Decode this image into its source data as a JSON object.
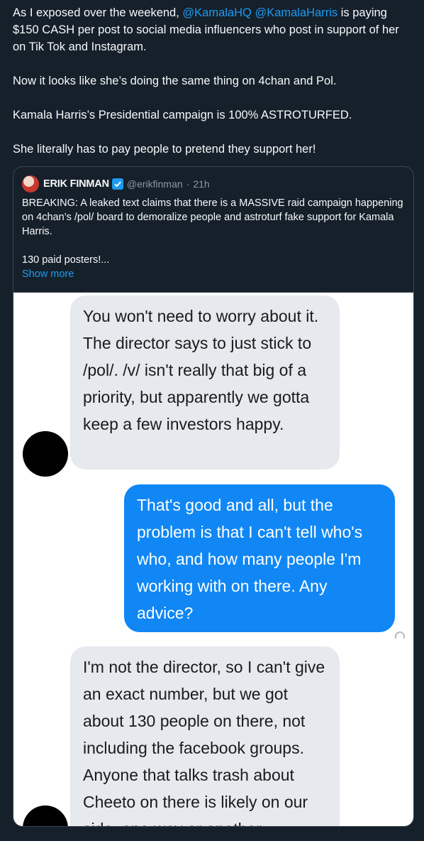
{
  "tweet": {
    "line1_pre": "As I exposed over the weekend, ",
    "mention1": "@KamalaHQ",
    "mention2": "@KamalaHarris",
    "line1_post": " is paying $150 CASH per post to social media influencers who post in support of her on Tik Tok and Instagram.",
    "para2": "Now it looks like she’s doing the same thing on 4chan and Pol.",
    "para3": "Kamala Harris’s Presidential campaign is 100% ASTROTURFED.",
    "para4": "She literally has to pay people to pretend they support her!"
  },
  "quote": {
    "name": "ERIK FINMAN",
    "handle": "@erikfinman",
    "separator": "·",
    "time": "21h",
    "body1": "BREAKING: A leaked text claims that there is a MASSIVE raid campaign happening on 4chan’s /pol/ board to demoralize people and astroturf fake support for Kamala Harris.",
    "body2": "130 paid posters!...",
    "show_more": "Show more"
  },
  "messages": [
    {
      "from": "them",
      "text": "You won't need to worry about it. The director says to just stick to /pol/. /v/ isn't really that big of a priority, but apparently we gotta keep a few investors happy."
    },
    {
      "from": "me",
      "text": "That's good and all, but the problem is that I can't tell who's who, and how many people I'm working with on there. Any advice?"
    },
    {
      "from": "them",
      "text": "I'm not the director, so I can't give an exact number, but we got about 130 people on there, not including the facebook groups. Anyone that talks trash about Cheeto on there is likely on our side, one way or another."
    }
  ],
  "colors": {
    "background": "#15202b",
    "link": "#1d9bf0",
    "bubble_out": "#1087f5",
    "bubble_in": "#e6e9ed"
  }
}
